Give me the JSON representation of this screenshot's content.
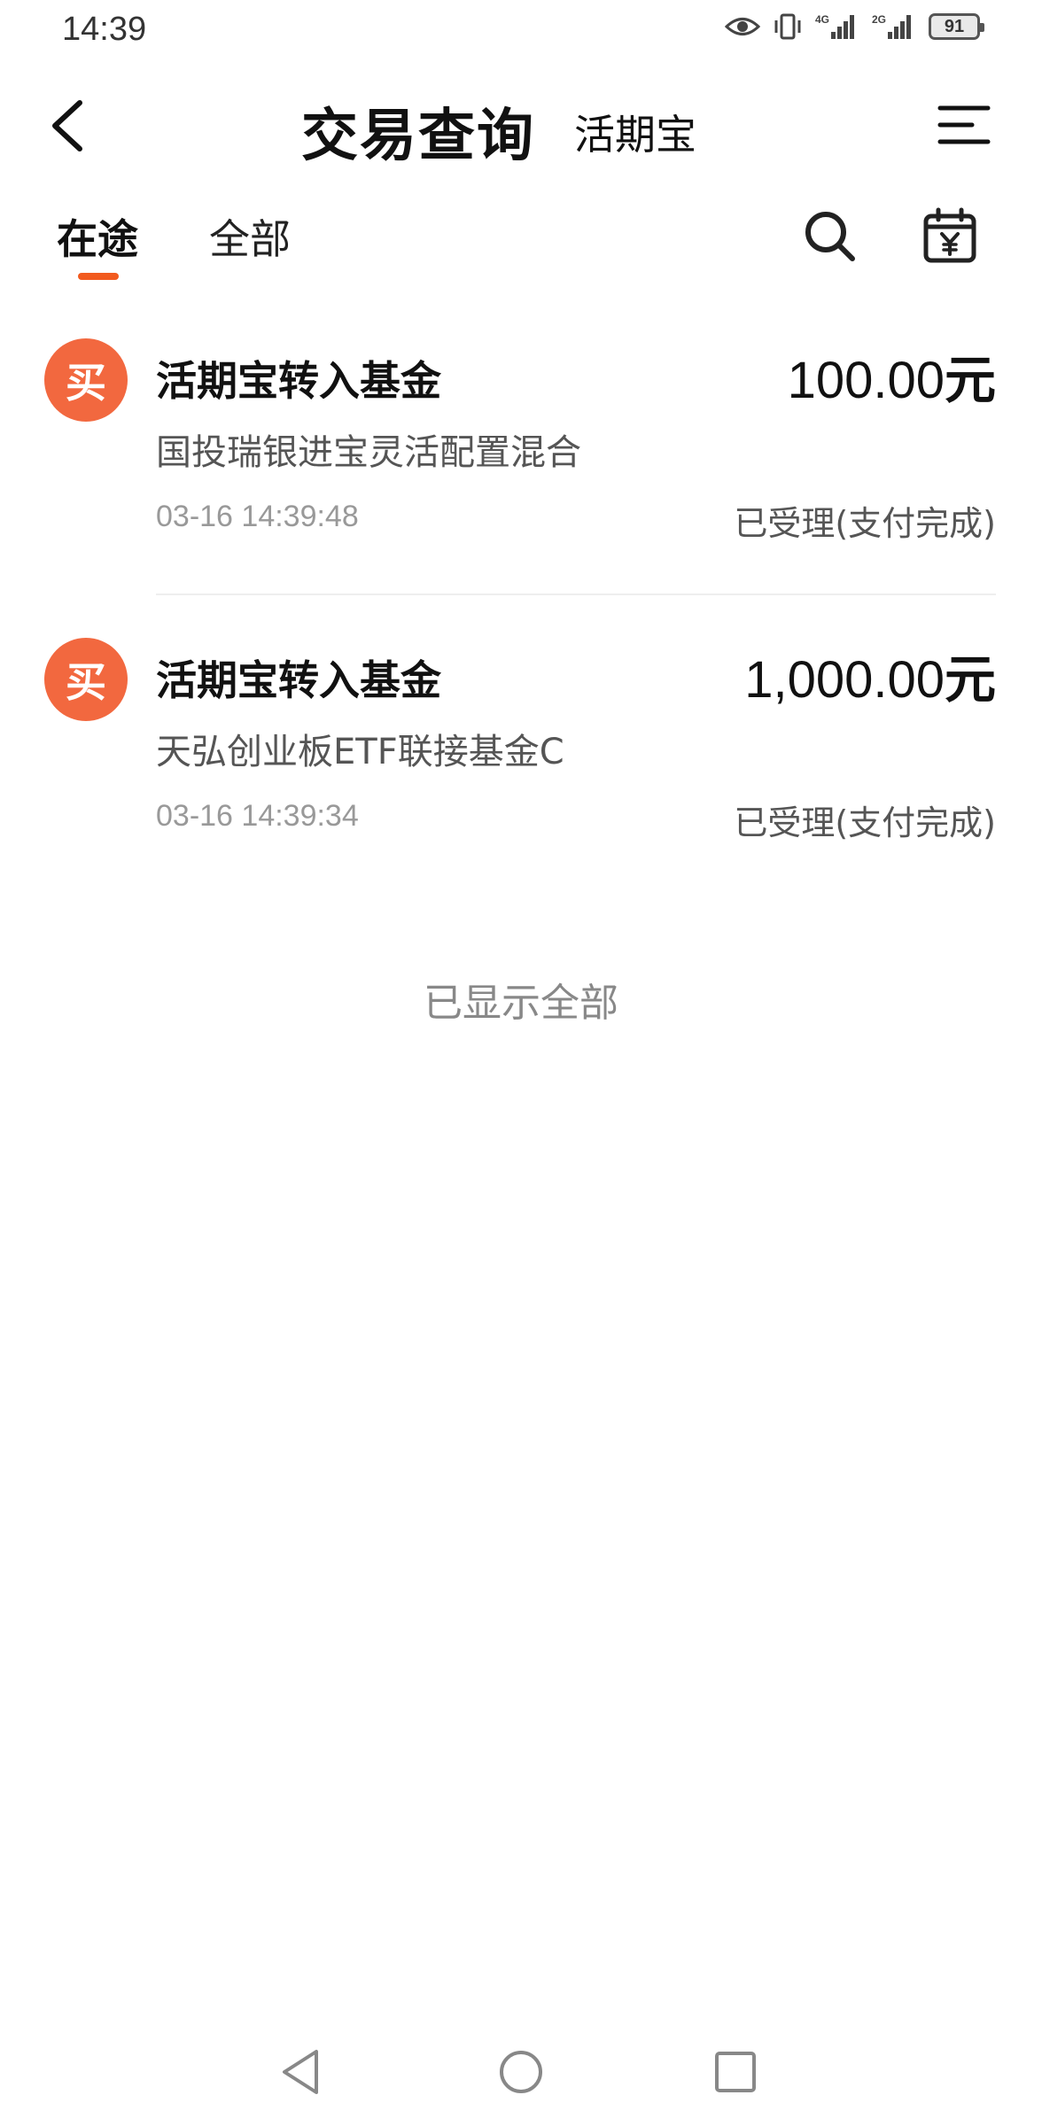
{
  "status_bar": {
    "time": "14:39",
    "battery": "91",
    "icons": [
      "eye-icon",
      "vibrate-icon",
      "signal-4g-icon",
      "signal-2g-icon",
      "battery-icon"
    ]
  },
  "header": {
    "back_icon": "chevron-left-icon",
    "title": "交易查询",
    "subtitle": "活期宝",
    "menu_icon": "menu-icon"
  },
  "tabs": {
    "items": [
      {
        "label": "在途",
        "active": true
      },
      {
        "label": "全部",
        "active": false
      }
    ],
    "search_icon": "search-icon",
    "calendar_icon": "calendar-yen-icon"
  },
  "transactions": [
    {
      "avatar_text": "买",
      "title": "活期宝转入基金",
      "amount": "100.00",
      "unit": "元",
      "fund_name": "国投瑞银进宝灵活配置混合",
      "time": "03-16 14:39:48",
      "status": "已受理(支付完成)"
    },
    {
      "avatar_text": "买",
      "title": "活期宝转入基金",
      "amount": "1,000.00",
      "unit": "元",
      "fund_name": "天弘创业板ETF联接基金C",
      "time": "03-16 14:39:34",
      "status": "已受理(支付完成)"
    }
  ],
  "end_hint": "已显示全部",
  "colors": {
    "accent": "#f25a1e",
    "avatar": "#f2683f",
    "secondary_text": "#555555",
    "muted_text": "#999999"
  },
  "nav_bar": {
    "icons": [
      "nav-back-icon",
      "nav-home-icon",
      "nav-recents-icon"
    ]
  }
}
